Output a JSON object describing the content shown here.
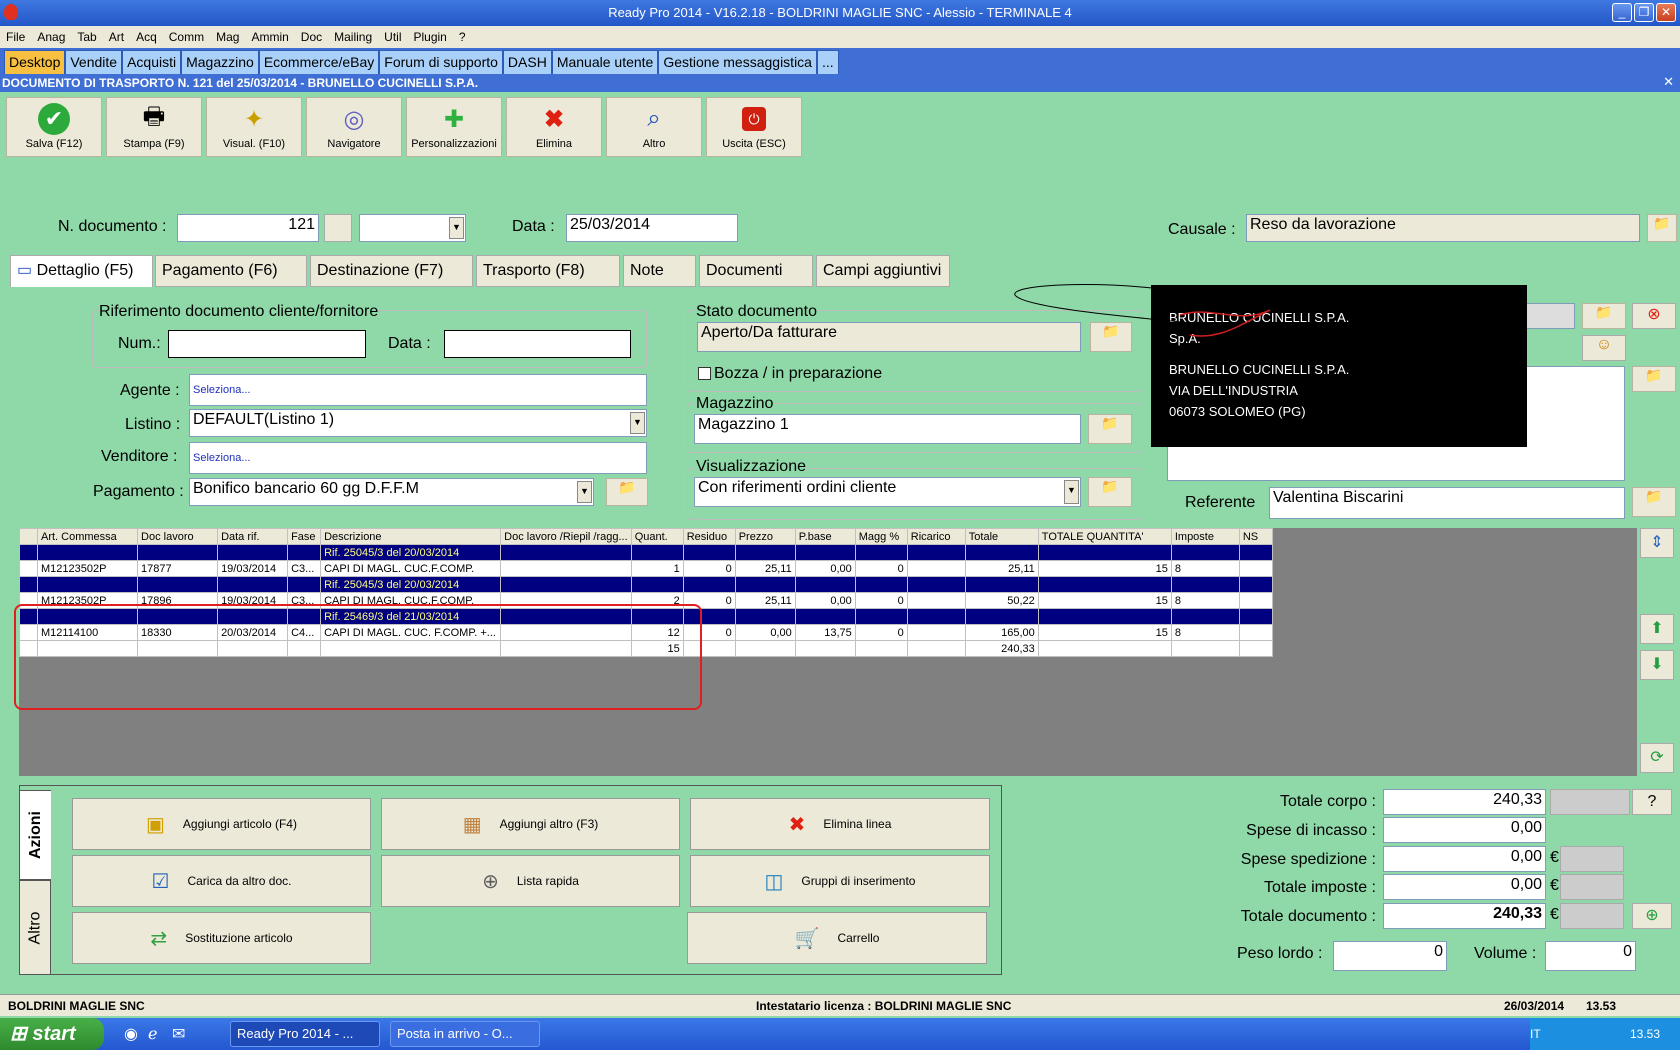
{
  "window": {
    "title": "Ready Pro 2014 - V16.2.18 - BOLDRINI MAGLIE SNC - Alessio - TERMINALE 4"
  },
  "menu": [
    "File",
    "Anag",
    "Tab",
    "Art",
    "Acq",
    "Comm",
    "Mag",
    "Ammin",
    "Doc",
    "Mailing",
    "Util",
    "Plugin",
    "?"
  ],
  "tabs": [
    "Desktop",
    "Vendite",
    "Acquisti",
    "Magazzino",
    "Ecommerce/eBay",
    "Forum di supporto",
    "DASH",
    "Manuale utente",
    "Gestione messaggistica",
    "..."
  ],
  "doc_title": "DOCUMENTO DI TRASPORTO N. 121 del 25/03/2014 - BRUNELLO CUCINELLI S.P.A.",
  "toolbar": [
    {
      "label": "Salva (F12)",
      "icon": "check-icon"
    },
    {
      "label": "Stampa (F9)",
      "icon": "printer-icon"
    },
    {
      "label": "Visual. (F10)",
      "icon": "magic-wand-icon"
    },
    {
      "label": "Navigatore",
      "icon": "navigator-icon"
    },
    {
      "label": "Personalizzazioni",
      "icon": "puzzle-icon"
    },
    {
      "label": "Elimina",
      "icon": "delete-icon"
    },
    {
      "label": "Altro",
      "icon": "search-icon"
    },
    {
      "label": "Uscita (ESC)",
      "icon": "exit-icon"
    }
  ],
  "header": {
    "ndoc_label": "N. documento :",
    "ndoc_value": "121",
    "data_label": "Data :",
    "data_value": "25/03/2014",
    "causale_label": "Causale :",
    "causale_value": "Reso da lavorazione"
  },
  "subtabs": [
    "Dettaglio (F5)",
    "Pagamento (F6)",
    "Destinazione (F7)",
    "Trasporto (F8)",
    "Note",
    "Documenti",
    "Campi aggiuntivi"
  ],
  "rif": {
    "title": "Riferimento documento cliente/fornitore",
    "num_label": "Num.:",
    "data_label": "Data :"
  },
  "fields": {
    "agente_label": "Agente :",
    "agente_value": "Seleziona...",
    "listino_label": "Listino :",
    "listino_value": "DEFAULT(Listino 1)",
    "venditore_label": "Venditore :",
    "venditore_value": "Seleziona...",
    "pagamento_label": "Pagamento :",
    "pagamento_value": "Bonifico bancario 60 gg D.F.F.M"
  },
  "stato": {
    "title": "Stato documento",
    "value": "Aperto/Da fatturare",
    "bozza": "Bozza / in preparazione"
  },
  "magazzino": {
    "title": "Magazzino",
    "value": "Magazzino 1"
  },
  "visual": {
    "title": "Visualizzazione",
    "value": "Con riferimenti ordini cliente"
  },
  "customer": {
    "line1": "BRUNELLO CUCINELLI S.P.A.",
    "line2": "Sp.A.",
    "line3": "BRUNELLO CUCINELLI S.P.A.",
    "line4": "VIA DELL'INDUSTRIA",
    "line5": "06073 SOLOMEO (PG)"
  },
  "referente": {
    "label": "Referente",
    "value": "Valentina Biscarini"
  },
  "grid": {
    "columns": [
      "Art. Commessa",
      "Doc lavoro",
      "Data rif.",
      "Fase",
      "Descrizione",
      "Doc lavoro /Riepil /ragg...",
      "Quant.",
      "Residuo",
      "Prezzo",
      "P.base",
      "Magg %",
      "Ricarico",
      "Totale",
      "TOTALE QUANTITA'",
      "Imposte",
      "NS"
    ],
    "rows": [
      {
        "rif": "Rif. 25045/3 del 20/03/2014"
      },
      {
        "c": [
          "M12123502P",
          "17877",
          "19/03/2014",
          "C3...",
          "CAPI DI MAGL. CUC.F.COMP.",
          "",
          "1",
          "0",
          "25,11",
          "0,00",
          "0",
          "",
          "25,11",
          "15",
          "8",
          ""
        ]
      },
      {
        "rif": "Rif. 25045/3 del 20/03/2014"
      },
      {
        "c": [
          "M12123502P",
          "17896",
          "19/03/2014",
          "C3...",
          "CAPI DI MAGL. CUC.F.COMP.",
          "",
          "2",
          "0",
          "25,11",
          "0,00",
          "0",
          "",
          "50,22",
          "15",
          "8",
          ""
        ]
      },
      {
        "rif": "Rif. 25469/3 del 21/03/2014"
      },
      {
        "c": [
          "M12114100",
          "18330",
          "20/03/2014",
          "C4...",
          "CAPI DI MAGL. CUC. F.COMP. +...",
          "",
          "12",
          "0",
          "0,00",
          "13,75",
          "0",
          "",
          "165,00",
          "15",
          "8",
          ""
        ]
      },
      {
        "c": [
          "",
          "",
          "",
          "",
          "",
          "",
          "15",
          "",
          "",
          "",
          "",
          "",
          "240,33",
          "",
          "",
          ""
        ]
      }
    ]
  },
  "azioni": {
    "tab1": "Azioni",
    "tab2": "Altro",
    "buttons": [
      {
        "label": "Aggiungi articolo (F4)",
        "icon": "add-article-icon"
      },
      {
        "label": "Aggiungi altro (F3)",
        "icon": "add-other-icon"
      },
      {
        "label": "Elimina linea",
        "icon": "delete-icon"
      },
      {
        "label": "Carica da altro doc.",
        "icon": "load-doc-icon"
      },
      {
        "label": "Lista rapida",
        "icon": "quick-list-icon"
      },
      {
        "label": "Gruppi di inserimento",
        "icon": "groups-icon"
      },
      {
        "label": "Sostituzione articolo",
        "icon": "replace-icon"
      },
      {
        "label": "Carrello",
        "icon": "cart-icon"
      }
    ]
  },
  "totals": {
    "corpo_label": "Totale corpo :",
    "corpo": "240,33",
    "incasso_label": "Spese di incasso :",
    "incasso": "0,00",
    "spedizione_label": "Spese spedizione :",
    "spedizione": "0,00",
    "imposte_label": "Totale imposte :",
    "imposte": "0,00",
    "documento_label": "Totale documento :",
    "documento": "240,33",
    "currency": "€",
    "peso_label": "Peso lordo :",
    "peso": "0",
    "volume_label": "Volume :",
    "volume": "0",
    "help": "?"
  },
  "status": {
    "company": "BOLDRINI MAGLIE SNC",
    "license": "Intestatario licenza : BOLDRINI MAGLIE SNC",
    "date": "26/03/2014",
    "time": "13.53"
  },
  "taskbar": {
    "start": "start",
    "task1": "Ready Pro 2014 - ...",
    "task2": "Posta in arrivo - O...",
    "lang": "IT",
    "clock": "13.53"
  }
}
